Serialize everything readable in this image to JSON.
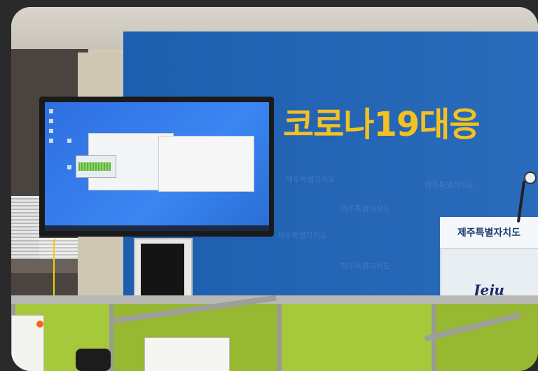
{
  "scene": {
    "headline": "코로나19대응",
    "podium_label": "제주특별자치도",
    "logo_text": "Jeju",
    "watermarks": [
      "제주특별자치도",
      "제주특별자치도",
      "제주특별자치도",
      "제주특별자치도",
      "제주특별자치도"
    ],
    "colors": {
      "backdrop": "#1f63b7",
      "headline": "#f2c122",
      "partition": "#a6c93c"
    }
  }
}
